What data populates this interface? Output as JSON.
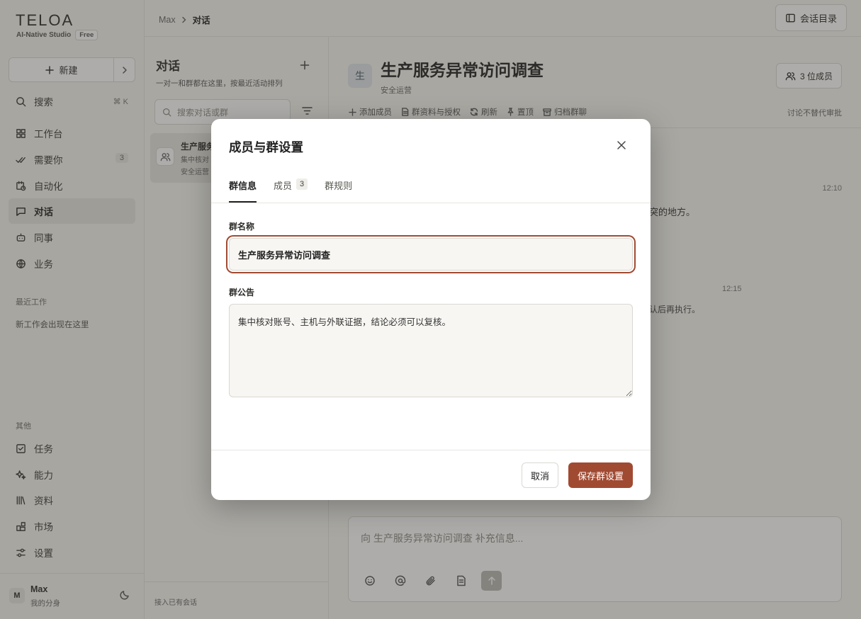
{
  "app": {
    "logo": "TELOA",
    "subtitle": "AI-Native Studio",
    "plan_badge": "Free"
  },
  "sidebar": {
    "new_label": "新建",
    "search": {
      "label": "搜索",
      "shortcut": "⌘ K"
    },
    "items": [
      {
        "label": "工作台",
        "icon": "grid-icon"
      },
      {
        "label": "需要你",
        "icon": "double-check-icon",
        "count": "3"
      },
      {
        "label": "自动化",
        "icon": "calendar-clock-icon"
      },
      {
        "label": "对话",
        "icon": "chat-bubble-icon",
        "active": true
      },
      {
        "label": "同事",
        "icon": "robot-icon"
      },
      {
        "label": "业务",
        "icon": "globe-icon"
      }
    ],
    "recent_heading": "最近工作",
    "recent_note": "新工作会出现在这里",
    "other_heading": "其他",
    "other_items": [
      {
        "label": "任务",
        "icon": "checkbox-icon"
      },
      {
        "label": "能力",
        "icon": "sparkle-icon"
      },
      {
        "label": "资料",
        "icon": "library-icon"
      },
      {
        "label": "市场",
        "icon": "blocks-icon"
      },
      {
        "label": "设置",
        "icon": "sliders-icon"
      }
    ],
    "user": {
      "initial": "M",
      "name": "Max",
      "sub": "我的分身"
    }
  },
  "topbar": {
    "breadcrumb": [
      "Max",
      "对话"
    ],
    "directory_button": "会话目录"
  },
  "conversations": {
    "title": "对话",
    "subtitle": "一对一和群都在这里，按最近活动排列",
    "search_placeholder": "搜索对话或群",
    "items": [
      {
        "title": "生产服务",
        "line1": "集中核对",
        "line2": "安全运营"
      }
    ],
    "footer": "接入已有会话"
  },
  "chat": {
    "avatar": "生",
    "title": "生产服务异常访问调查",
    "subtitle": "安全运营",
    "members_button": "3 位成员",
    "tools": [
      "添加成员",
      "群资料与授权",
      "刷新",
      "置顶",
      "归档群聊"
    ],
    "tools_note": "讨论不替代审批",
    "messages": [
      {
        "time": "12:10",
        "text": "突的地方。"
      },
      {
        "time": "12:15",
        "text": "认后再执行。"
      }
    ],
    "composer_placeholder": "向 生产服务异常访问调查 补充信息..."
  },
  "modal": {
    "title": "成员与群设置",
    "tabs": [
      {
        "label": "群信息",
        "active": true
      },
      {
        "label": "成员",
        "count": "3"
      },
      {
        "label": "群规则"
      }
    ],
    "name_label": "群名称",
    "name_value": "生产服务异常访问调查",
    "notice_label": "群公告",
    "notice_value": "集中核对账号、主机与外联证据，结论必须可以复核。",
    "cancel": "取消",
    "save": "保存群设置"
  },
  "colors": {
    "accent": "#a14a32",
    "active_nav": "#e6e5df",
    "background": "#f7f6f2"
  }
}
